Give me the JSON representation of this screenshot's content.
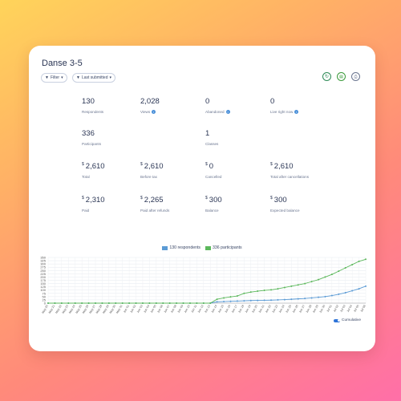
{
  "title": "Danse 3-5",
  "filters": {
    "filter_label": "Filter",
    "last_submitted_label": "Last submitted"
  },
  "stats": [
    {
      "value": "130",
      "currency": "",
      "label": "Respondents",
      "info": false
    },
    {
      "value": "2,028",
      "currency": "",
      "label": "Views",
      "info": true
    },
    {
      "value": "0",
      "currency": "",
      "label": "Abandoned",
      "info": true
    },
    {
      "value": "0",
      "currency": "",
      "label": "Live right now",
      "info": true
    },
    {
      "value": "336",
      "currency": "",
      "label": "Participants",
      "info": false
    },
    {
      "value": "1",
      "currency": "",
      "label": "Classes",
      "info": false
    },
    {
      "value": "2,610",
      "currency": "$",
      "label": "Total",
      "info": false
    },
    {
      "value": "2,610",
      "currency": "$",
      "label": "Before tax",
      "info": false
    },
    {
      "value": "0",
      "currency": "$",
      "label": "Cancelled",
      "info": false
    },
    {
      "value": "2,610",
      "currency": "$",
      "label": "Total after cancellations",
      "info": false
    },
    {
      "value": "2,310",
      "currency": "$",
      "label": "Paid",
      "info": false
    },
    {
      "value": "2,265",
      "currency": "$",
      "label": "Paid after refunds",
      "info": false
    },
    {
      "value": "300",
      "currency": "$",
      "label": "Balance",
      "info": false
    },
    {
      "value": "300",
      "currency": "$",
      "label": "Expected balance",
      "info": false
    }
  ],
  "toggle_label": "Cumulative",
  "icons": [
    "filter-icon",
    "chevron-down-icon",
    "refresh-icon",
    "excel-icon",
    "print-icon",
    "info-icon"
  ],
  "colors": {
    "respondents": "#5b9bd5",
    "participants": "#5cb85c",
    "refresh": "#2e8b57",
    "excel": "#3a9a3a"
  },
  "chart_data": {
    "type": "line",
    "ylim": [
      0,
      350
    ],
    "yticks": [
      0,
      25,
      50,
      75,
      100,
      125,
      150,
      175,
      200,
      225,
      250,
      275,
      300,
      325,
      350
    ],
    "grid": true,
    "legend_position": "top",
    "categories": [
      "May 20",
      "May 21",
      "May 22",
      "May 23",
      "May 24",
      "May 25",
      "May 26",
      "May 27",
      "May 28",
      "May 29",
      "May 30",
      "May 31",
      "Jun 01",
      "Jun 02",
      "Jun 03",
      "Jun 04",
      "Jun 05",
      "Jun 06",
      "Jun 07",
      "Jun 08",
      "Jun 09",
      "Jun 10",
      "Jun 11",
      "Jun 12",
      "Jun 13",
      "Jun 14",
      "Jun 15",
      "Jun 16",
      "Jun 17",
      "Jun 18",
      "Jun 19",
      "Jun 20",
      "Jun 21",
      "Jun 22",
      "Jun 23",
      "Jun 24",
      "Jun 25",
      "Jun 26",
      "Jun 27",
      "Jun 28",
      "Jun 29",
      "Jun 30",
      "Jul 01",
      "Jul 02",
      "Jul 03",
      "Jul 04",
      "Jul 05",
      "Jul 06"
    ],
    "series": [
      {
        "name": "130 respondents",
        "color": "#5b9bd5",
        "values": [
          0,
          0,
          0,
          0,
          0,
          0,
          0,
          0,
          0,
          0,
          0,
          0,
          0,
          0,
          0,
          0,
          0,
          0,
          0,
          0,
          0,
          0,
          0,
          0,
          0,
          10,
          12,
          14,
          16,
          18,
          20,
          21,
          22,
          23,
          25,
          27,
          30,
          33,
          36,
          40,
          45,
          50,
          58,
          68,
          80,
          95,
          110,
          130
        ]
      },
      {
        "name": "336 participants",
        "color": "#5cb85c",
        "values": [
          0,
          0,
          0,
          0,
          0,
          0,
          0,
          0,
          0,
          0,
          0,
          0,
          0,
          0,
          0,
          0,
          0,
          0,
          0,
          0,
          0,
          0,
          0,
          0,
          0,
          30,
          40,
          48,
          55,
          75,
          85,
          92,
          98,
          102,
          110,
          120,
          130,
          140,
          150,
          165,
          180,
          200,
          220,
          245,
          270,
          295,
          320,
          336
        ]
      }
    ]
  }
}
